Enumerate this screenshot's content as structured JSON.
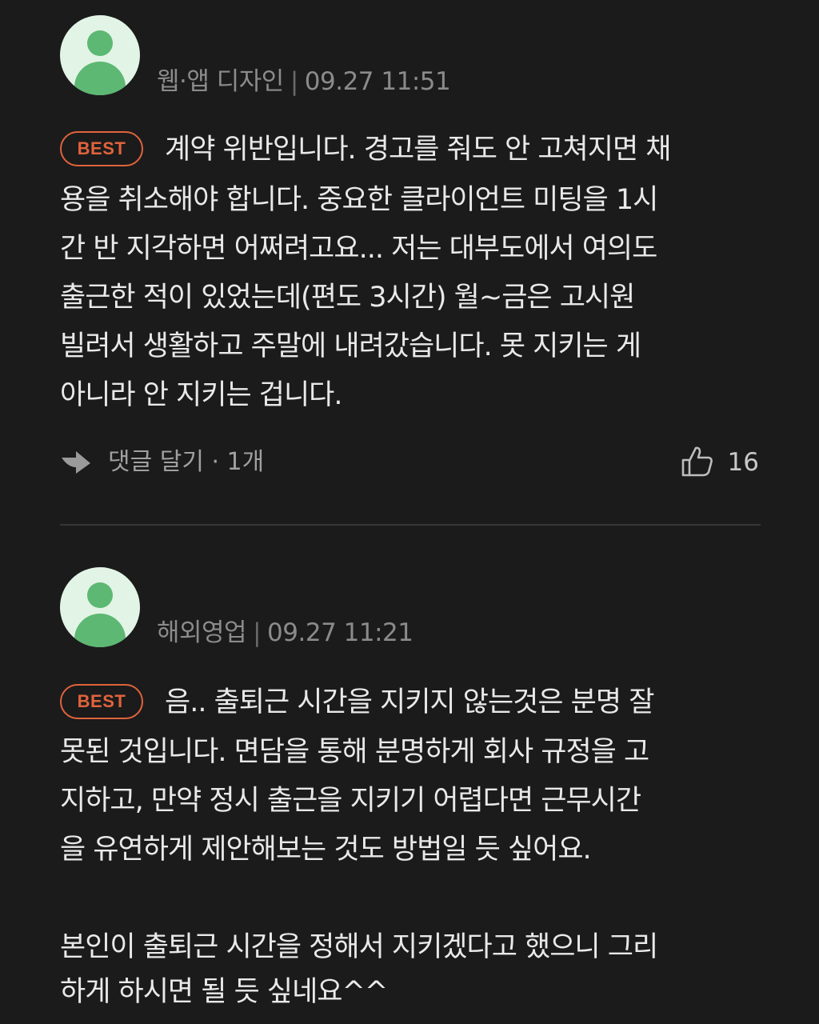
{
  "comments": [
    {
      "author": "웹·앱 디자인",
      "separator": "|",
      "timestamp": "09.27 11:51",
      "badge": "BEST",
      "lines": [
        "계약 위반입니다. 경고를 줘도 안 고쳐지면 채",
        "용을 취소해야 합니다. 중요한 클라이언트 미팅을 1시",
        "간 반 지각하면 어쩌려고요... 저는 대부도에서 여의도",
        "출근한 적이 있었는데(편도 3시간) 월~금은 고시원",
        "빌려서 생활하고 주말에 내려갔습니다. 못 지키는 게",
        "아니라 안 지키는 겁니다."
      ],
      "reply_label": "댓글 달기 · 1개",
      "likes": "16"
    },
    {
      "author": "해외영업",
      "separator": "|",
      "timestamp": "09.27 11:21",
      "badge": "BEST",
      "lines": [
        "음.. 출퇴근 시간을 지키지 않는것은 분명 잘",
        "못된 것입니다.  면담을 통해 분명하게 회사 규정을 고",
        "지하고, 만약 정시 출근을 지키기 어렵다면 근무시간",
        "을 유연하게 제안해보는 것도 방법일 듯 싶어요.",
        "",
        "본인이 출퇴근 시간을 정해서 지키겠다고 했으니 그리",
        "하게 하시면 될 듯 싶네요^^"
      ]
    }
  ],
  "icons": {
    "avatar": "default-user-avatar-icon",
    "reply": "reply-arrow-icon",
    "like": "thumbs-up-icon"
  },
  "colors": {
    "background": "#1b1b1b",
    "badge": "#e0633c",
    "avatar_bg": "#e2f4e6",
    "avatar_fg": "#5cb872",
    "text": "#e9e9e9",
    "meta": "#8b8b8b"
  }
}
